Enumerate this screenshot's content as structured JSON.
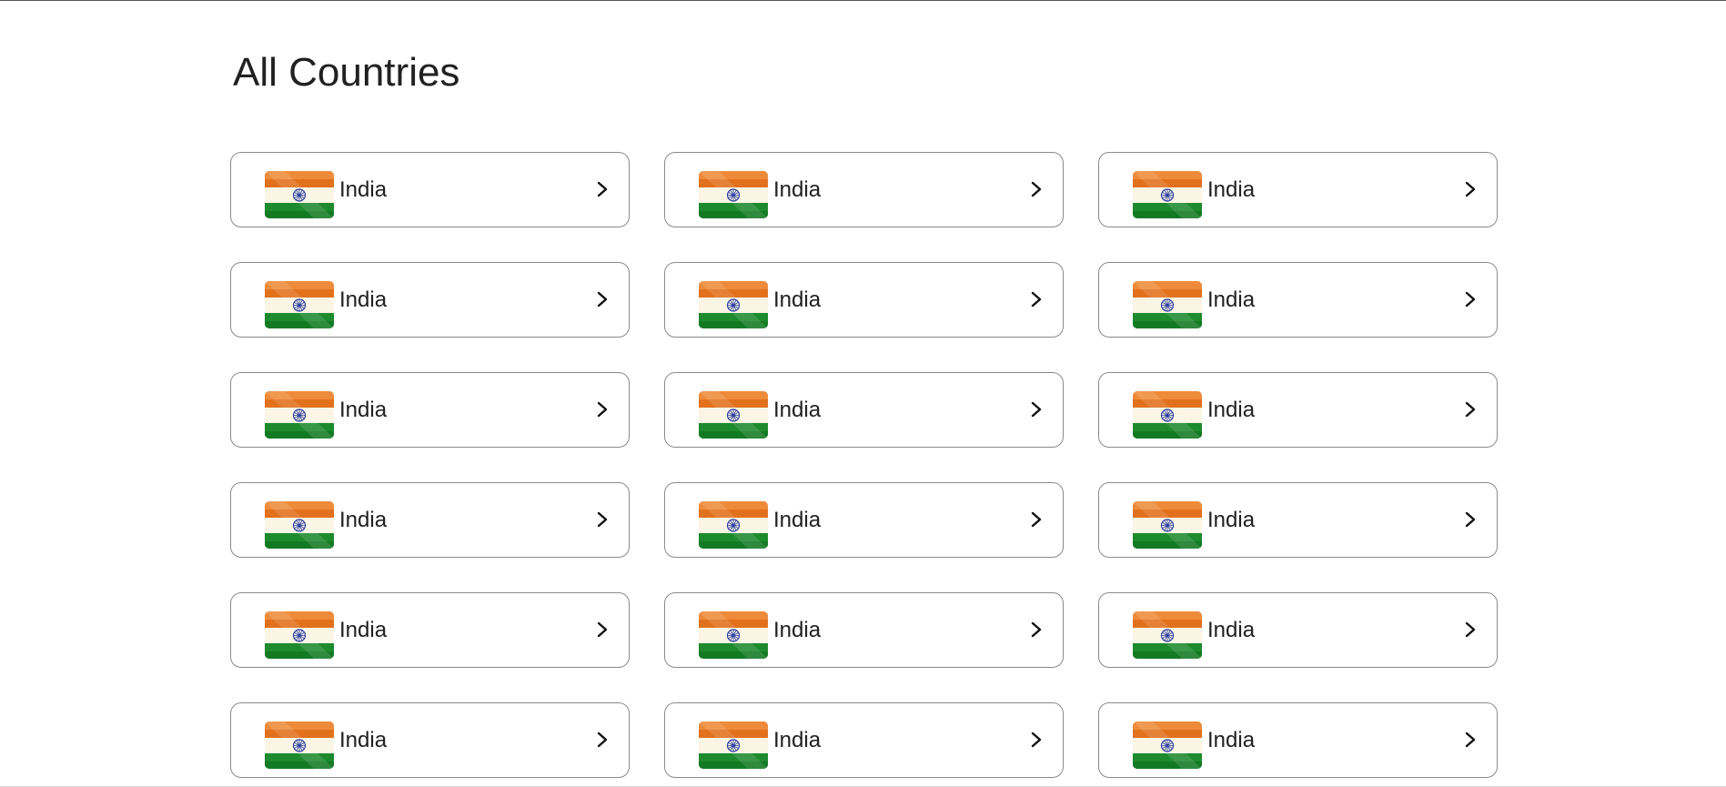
{
  "page": {
    "title": "All Countries"
  },
  "colors": {
    "saffron": "#E2711D",
    "saffron_light": "#EE8B3A",
    "white_band": "#FAF5E4",
    "green": "#1E8A2E",
    "green_dark": "#137A24",
    "chakra": "#2C3E9E",
    "card_border": "#8A8A8A",
    "text": "#202020"
  },
  "countries": [
    {
      "name": "India",
      "flag_icon": "india-flag-icon",
      "action_icon": "chevron-right-icon"
    },
    {
      "name": "India",
      "flag_icon": "india-flag-icon",
      "action_icon": "chevron-right-icon"
    },
    {
      "name": "India",
      "flag_icon": "india-flag-icon",
      "action_icon": "chevron-right-icon"
    },
    {
      "name": "India",
      "flag_icon": "india-flag-icon",
      "action_icon": "chevron-right-icon"
    },
    {
      "name": "India",
      "flag_icon": "india-flag-icon",
      "action_icon": "chevron-right-icon"
    },
    {
      "name": "India",
      "flag_icon": "india-flag-icon",
      "action_icon": "chevron-right-icon"
    },
    {
      "name": "India",
      "flag_icon": "india-flag-icon",
      "action_icon": "chevron-right-icon"
    },
    {
      "name": "India",
      "flag_icon": "india-flag-icon",
      "action_icon": "chevron-right-icon"
    },
    {
      "name": "India",
      "flag_icon": "india-flag-icon",
      "action_icon": "chevron-right-icon"
    },
    {
      "name": "India",
      "flag_icon": "india-flag-icon",
      "action_icon": "chevron-right-icon"
    },
    {
      "name": "India",
      "flag_icon": "india-flag-icon",
      "action_icon": "chevron-right-icon"
    },
    {
      "name": "India",
      "flag_icon": "india-flag-icon",
      "action_icon": "chevron-right-icon"
    },
    {
      "name": "India",
      "flag_icon": "india-flag-icon",
      "action_icon": "chevron-right-icon"
    },
    {
      "name": "India",
      "flag_icon": "india-flag-icon",
      "action_icon": "chevron-right-icon"
    },
    {
      "name": "India",
      "flag_icon": "india-flag-icon",
      "action_icon": "chevron-right-icon"
    },
    {
      "name": "India",
      "flag_icon": "india-flag-icon",
      "action_icon": "chevron-right-icon"
    },
    {
      "name": "India",
      "flag_icon": "india-flag-icon",
      "action_icon": "chevron-right-icon"
    },
    {
      "name": "India",
      "flag_icon": "india-flag-icon",
      "action_icon": "chevron-right-icon"
    }
  ]
}
